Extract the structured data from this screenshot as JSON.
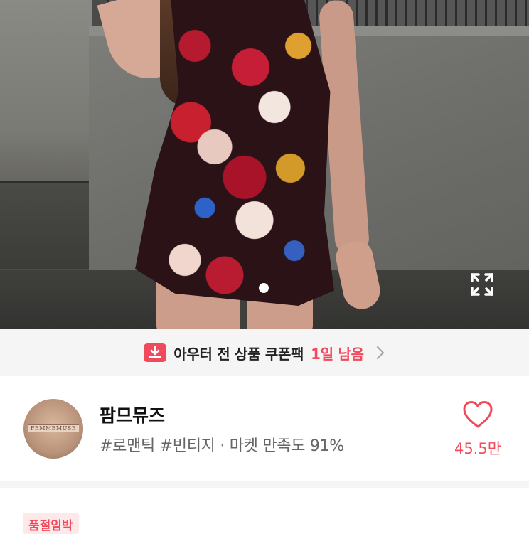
{
  "photo": {
    "alt": "floral mini dress",
    "current_slide": 1
  },
  "coupon": {
    "icon": "download-coupon-icon",
    "text": "아우터 전 상품 쿠폰팩",
    "remaining": "1일 남음",
    "accent": "#f04a5c"
  },
  "shop": {
    "avatar_text": "FEMMEMUSE",
    "name": "팜므뮤즈",
    "tag1": "#로맨틱",
    "tag2": "#빈티지",
    "separator": "·",
    "satisfaction": "마켓 만족도 91%",
    "likes": "45.5만"
  },
  "badge": {
    "label": "품절임박"
  }
}
